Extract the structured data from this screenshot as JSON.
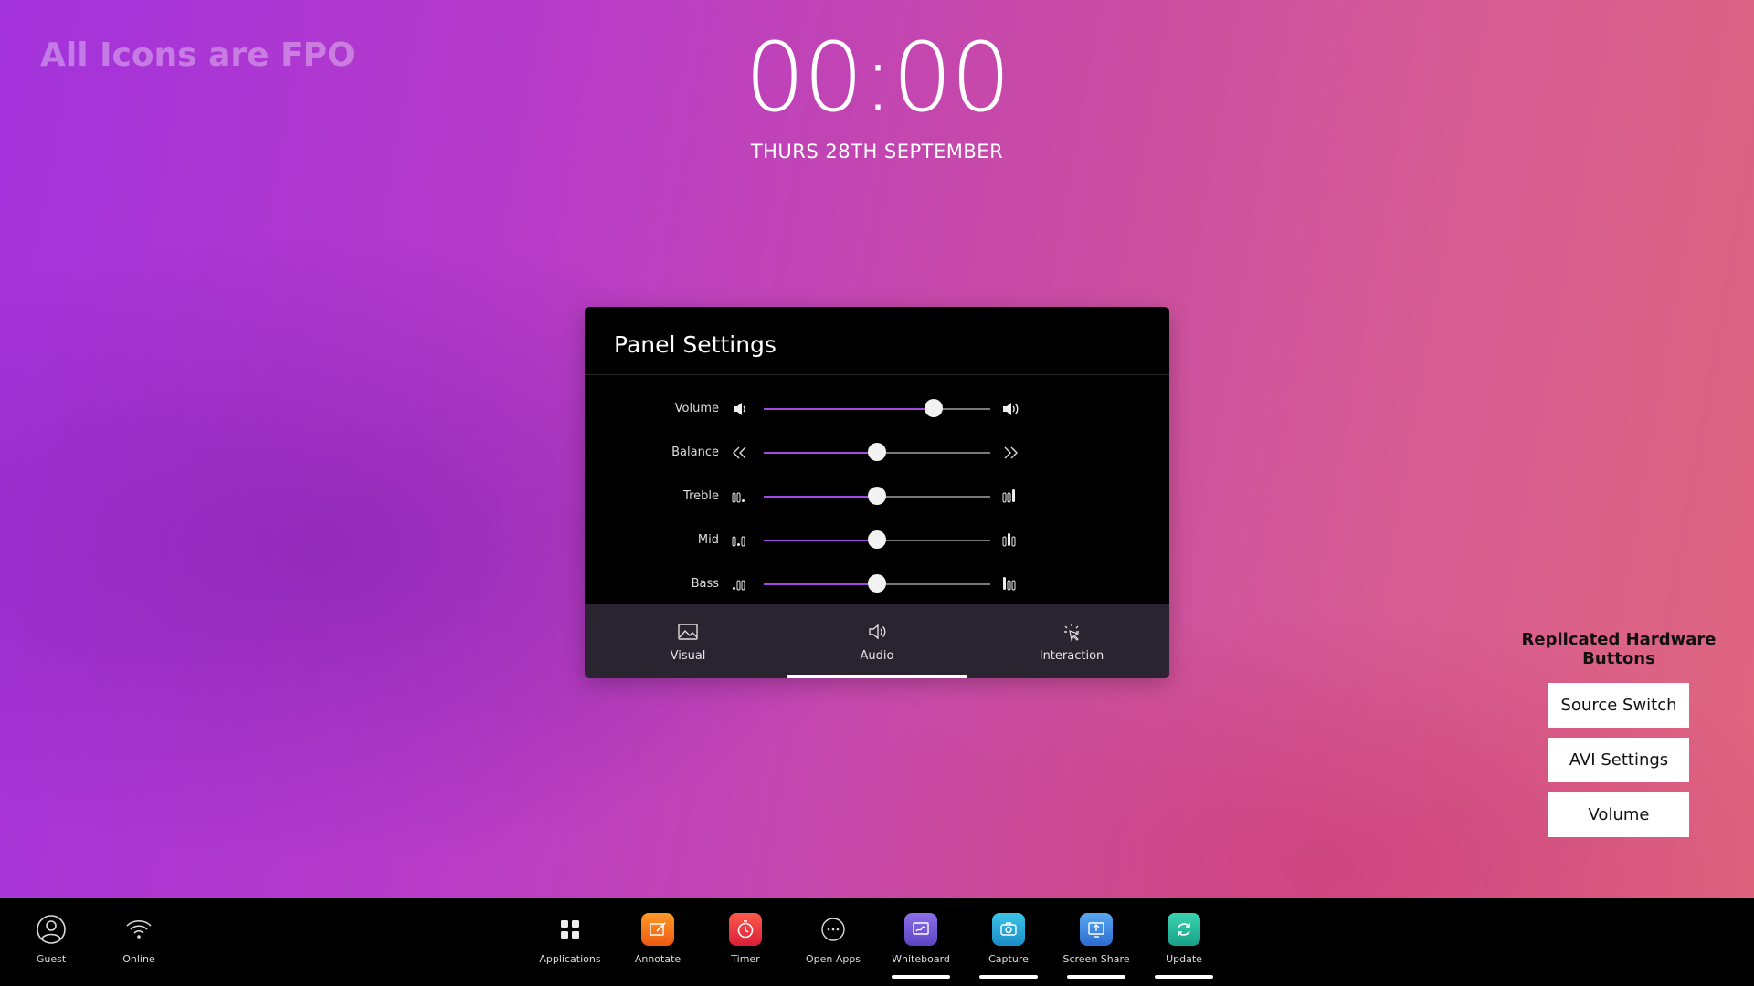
{
  "watermark": "All Icons are FPO",
  "clock": {
    "time": "00:00",
    "date": "THURS 28TH SEPTEMBER"
  },
  "panel": {
    "title": "Panel Settings",
    "sliders": [
      {
        "label": "Volume",
        "value": 0.75,
        "icon_left": "volume-low-icon",
        "icon_right": "volume-high-icon"
      },
      {
        "label": "Balance",
        "value": 0.5,
        "icon_left": "chevrons-left-icon",
        "icon_right": "chevrons-right-icon"
      },
      {
        "label": "Treble",
        "value": 0.5,
        "icon_left": "treble-low-icon",
        "icon_right": "treble-high-icon"
      },
      {
        "label": "Mid",
        "value": 0.5,
        "icon_left": "mid-low-icon",
        "icon_right": "mid-high-icon"
      },
      {
        "label": "Bass",
        "value": 0.5,
        "icon_left": "bass-low-icon",
        "icon_right": "bass-high-icon"
      }
    ],
    "tabs": [
      {
        "label": "Visual",
        "icon": "image-icon"
      },
      {
        "label": "Audio",
        "icon": "speaker-icon"
      },
      {
        "label": "Interaction",
        "icon": "touch-icon"
      }
    ],
    "active_tab": "Audio",
    "accent_color": "#a348e0"
  },
  "hardware": {
    "title": "Replicated Hardware Buttons",
    "buttons": [
      "Source Switch",
      "AVI Settings",
      "Volume"
    ]
  },
  "taskbar": {
    "left": [
      {
        "label": "Guest",
        "icon": "user-icon"
      },
      {
        "label": "Online",
        "icon": "wifi-icon"
      }
    ],
    "apps": [
      {
        "label": "Applications",
        "icon": "grid-icon",
        "active": false
      },
      {
        "label": "Annotate",
        "icon": "annotate-icon",
        "color": "#f07a1a",
        "active": false
      },
      {
        "label": "Timer",
        "icon": "timer-icon",
        "color": "#e8343c",
        "active": false
      },
      {
        "label": "Open Apps",
        "icon": "more-icon",
        "active": false
      },
      {
        "label": "Whiteboard",
        "icon": "whiteboard-icon",
        "color": "#7a5cd6",
        "active": true
      },
      {
        "label": "Capture",
        "icon": "camera-icon",
        "color": "#2aa8d8",
        "active": true
      },
      {
        "label": "Screen Share",
        "icon": "screen-share-icon",
        "color": "#3d8ee0",
        "active": true
      },
      {
        "label": "Update",
        "icon": "refresh-icon",
        "color": "#2cb89a",
        "active": true
      }
    ]
  }
}
